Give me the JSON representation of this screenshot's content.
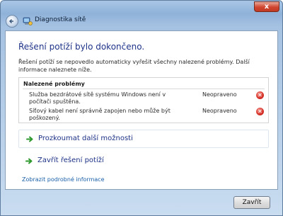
{
  "window": {
    "title": "Diagnostika sítě",
    "close_glyph": "x"
  },
  "main": {
    "heading": "Řešení potíží bylo dokončeno.",
    "intro": "Řešení potíží se nepovedlo automaticky vyřešit všechny nalezené problémy. Další informace naleznete níže."
  },
  "problems": {
    "header": "Nalezené problémy",
    "items": [
      {
        "text": "Služba bezdrátové sítě systému Windows není v počítači spuštěna.",
        "status": "Neopraveno",
        "icon": "error-icon"
      },
      {
        "text": "Síťový kabel není správně zapojen nebo může být poškozený.",
        "status": "Neopraveno",
        "icon": "error-icon"
      }
    ]
  },
  "options": [
    {
      "label": "Prozkoumat další možnosti",
      "icon": "green-arrow-icon"
    },
    {
      "label": "Zavřít řešení potíží",
      "icon": "green-arrow-icon"
    }
  ],
  "details_link": "Zobrazit podrobné informace",
  "footer": {
    "close_label": "Zavřít"
  },
  "colors": {
    "heading": "#1e3287",
    "link": "#1a5fa8",
    "error": "#d8342b",
    "arrow": "#2f9a2f"
  }
}
